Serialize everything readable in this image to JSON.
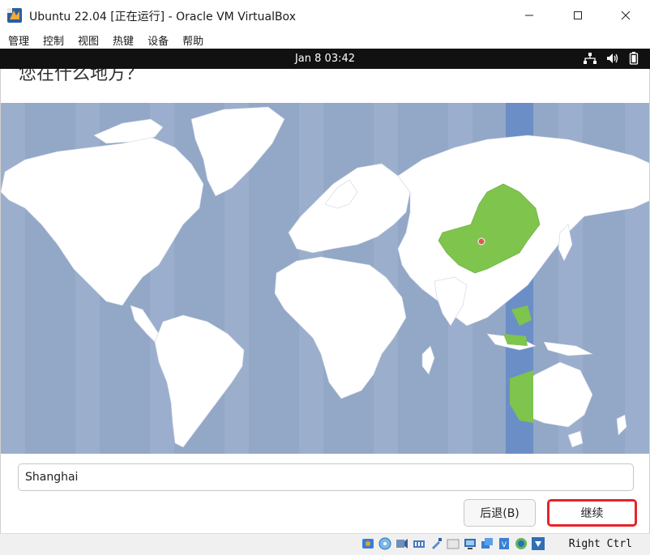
{
  "window": {
    "title": "Ubuntu 22.04 [正在运行] - Oracle VM VirtualBox",
    "controls": [
      "minimize",
      "maximize",
      "close"
    ]
  },
  "menubar": {
    "items": [
      "管理",
      "控制",
      "视图",
      "热键",
      "设备",
      "帮助"
    ]
  },
  "guest_topbar": {
    "clock": "Jan 8  03:42",
    "status_icons": [
      "network-icon",
      "volume-icon",
      "battery-icon"
    ]
  },
  "installer": {
    "heading": "您在什么地方？",
    "map": {
      "selected_timezone_highlight": "China / UTC+8",
      "pin_city": "Shanghai",
      "colors": {
        "ocean": "#93a7c7",
        "land": "#ffffff",
        "selected_zone": "#7ec44d",
        "zone_band": "#6b8ec7",
        "pin": "#e05a4f"
      }
    },
    "location": {
      "value": "Shanghai",
      "placeholder": ""
    },
    "buttons": {
      "back": "后退(B)",
      "continue": "继续"
    }
  },
  "vbox_statusbar": {
    "icons": [
      "hard-disk-icon",
      "optical-drive-icon",
      "audio-icon",
      "network-adapter-icon",
      "usb-icon",
      "shared-folder-icon",
      "display-icon",
      "video-capture-icon",
      "cpu-icon",
      "recording-icon",
      "arrow-down-icon"
    ],
    "host_key": "Right Ctrl"
  }
}
